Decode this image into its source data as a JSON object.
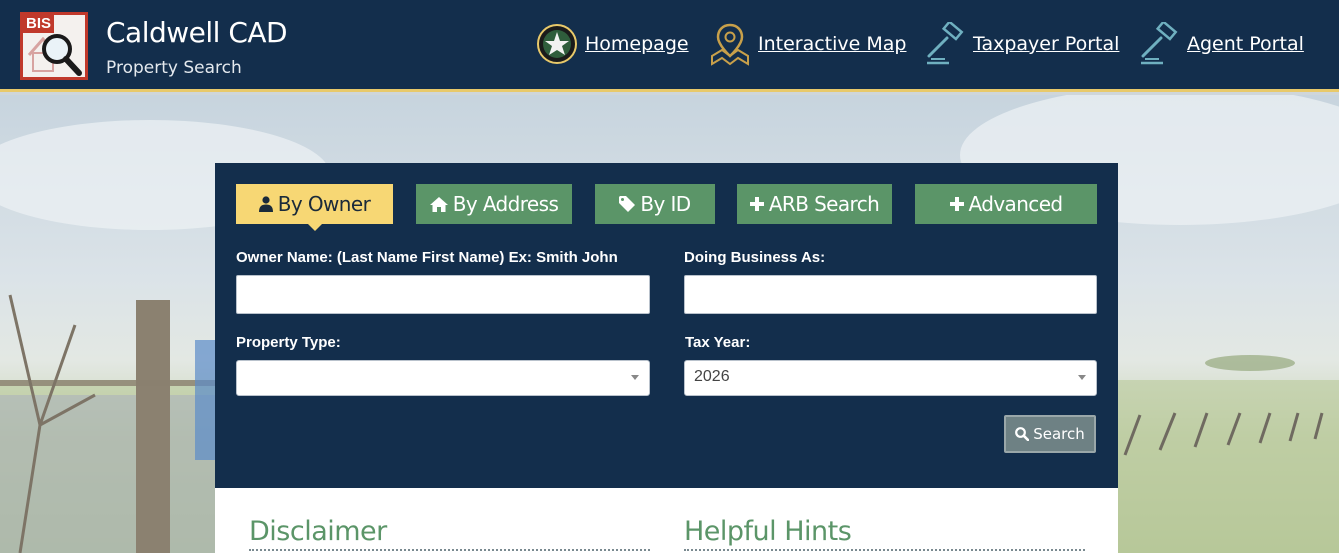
{
  "header": {
    "logo_badge": "BIS",
    "title": "Caldwell CAD",
    "subtitle": "Property Search",
    "nav": [
      {
        "label": "Homepage",
        "icon": "texas-star-seal-icon"
      },
      {
        "label": "Interactive Map",
        "icon": "map-pin-icon"
      },
      {
        "label": "Taxpayer Portal",
        "icon": "gavel-icon"
      },
      {
        "label": "Agent Portal",
        "icon": "gavel-icon"
      }
    ]
  },
  "search": {
    "tabs": [
      {
        "label": "By Owner",
        "icon": "user-icon",
        "active": true
      },
      {
        "label": "By Address",
        "icon": "home-icon",
        "active": false
      },
      {
        "label": "By ID",
        "icon": "tag-icon",
        "active": false
      },
      {
        "label": "ARB Search",
        "icon": "plus-icon",
        "active": false
      },
      {
        "label": "Advanced",
        "icon": "plus-icon",
        "active": false
      }
    ],
    "owner_name_label": "Owner Name: (Last Name First Name) Ex: Smith John",
    "owner_name_value": "",
    "dba_label": "Doing Business As:",
    "dba_value": "",
    "property_type_label": "Property Type:",
    "property_type_value": "",
    "tax_year_label": "Tax Year:",
    "tax_year_value": "2026",
    "search_button": "Search"
  },
  "content": {
    "disclaimer_title": "Disclaimer",
    "hints_title": "Helpful Hints"
  },
  "colors": {
    "navy": "#132e4c",
    "tab_green": "#5b9568",
    "tab_active": "#f7d774",
    "accent_gold": "#e8c96a"
  }
}
